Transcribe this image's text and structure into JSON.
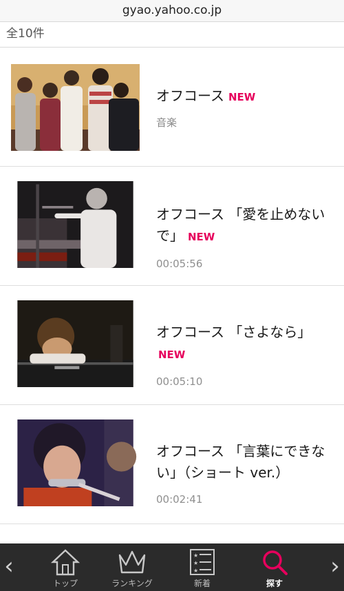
{
  "browser": {
    "url": "gyao.yahoo.co.jp"
  },
  "results": {
    "count_label": "全10件"
  },
  "videos": [
    {
      "title": "オフコース",
      "badge": "NEW",
      "category": "音楽",
      "duration": ""
    },
    {
      "title": "オフコース 「愛を止めないで」",
      "badge": "NEW",
      "category": "",
      "duration": "00:05:56"
    },
    {
      "title": "オフコース 「さよなら」",
      "badge": "NEW",
      "category": "",
      "duration": "00:05:10"
    },
    {
      "title": "オフコース 「言葉にできない」（ショート ver.）",
      "badge": "",
      "category": "",
      "duration": "00:02:41"
    }
  ],
  "tabbar": {
    "prev_arrow": "‹",
    "next_arrow": "›",
    "tabs": [
      {
        "label": "トップ",
        "icon": "home-icon"
      },
      {
        "label": "ランキング",
        "icon": "crown-icon"
      },
      {
        "label": "新着",
        "icon": "list-icon"
      },
      {
        "label": "探す",
        "icon": "search-icon",
        "active": true
      }
    ]
  },
  "colors": {
    "accent": "#e6005c",
    "tabbar_bg": "#2b2b2b"
  }
}
